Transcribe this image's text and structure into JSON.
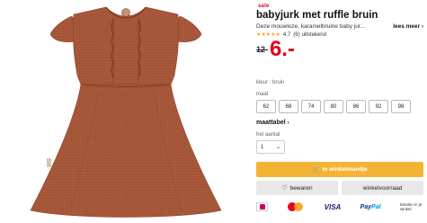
{
  "product": {
    "badge": "sale",
    "title": "babyjurk met ruffle bruin",
    "description": "Deze mouwloze, karamelbruine baby jur...",
    "read_more": "lees meer",
    "rating_stars": 4.7,
    "rating_score": "4.7",
    "rating_count": "(6)",
    "rating_label": "uitstekend",
    "old_price": "12-",
    "new_price": "6.-",
    "color_label": "kleur : bruin",
    "size_label": "maat",
    "sizes": [
      "62",
      "68",
      "74",
      "80",
      "86",
      "92",
      "98"
    ],
    "size_table_link": "maattabel",
    "quantity_label": "het aantal",
    "quantity_value": "1",
    "add_to_cart": "in winkelmandje",
    "save_button": "bewaren",
    "stock_button": "winkelvoorraad",
    "image_alt": "babyjurk met ruffle bruin"
  },
  "payments": {
    "ideal": "iDEAL",
    "visa": "VISA",
    "paypal_a": "Pay",
    "paypal_b": "Pal",
    "later": "betalen in je winkel"
  },
  "colors": {
    "sale_red": "#e0001b",
    "price_red": "#e0001b",
    "cart_orange": "#f5b335",
    "dress_brown": "#a8583b",
    "star_yellow": "#f5a623"
  }
}
